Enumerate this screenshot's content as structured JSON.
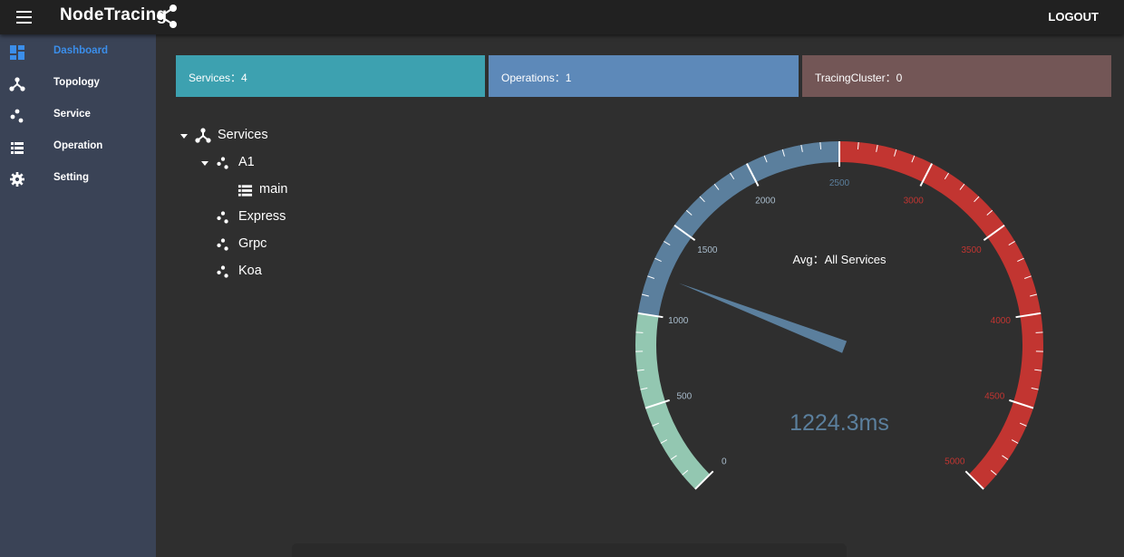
{
  "appbar": {
    "title": "NodeTracing",
    "logout": "LOGOUT"
  },
  "sidebar": {
    "items": [
      {
        "label": "Dashboard",
        "icon": "dashboard-icon",
        "active": true
      },
      {
        "label": "Topology",
        "icon": "topology-icon"
      },
      {
        "label": "Service",
        "icon": "service-icon"
      },
      {
        "label": "Operation",
        "icon": "operation-icon"
      },
      {
        "label": "Setting",
        "icon": "gear-icon"
      }
    ]
  },
  "stats": {
    "services": "Services：4",
    "operations": "Operations：1",
    "cluster": "TracingCluster：0",
    "colors": {
      "services": "#3da1b0",
      "operations": "#5d89b9",
      "cluster": "#735656"
    }
  },
  "tree": {
    "root": "Services",
    "a1": "A1",
    "main": "main",
    "express": "Express",
    "grpc": "Grpc",
    "koa": "Koa"
  },
  "gauge": {
    "title": "Avg：All Services",
    "value": 1224.3,
    "value_text": "1224.3ms",
    "min": 0,
    "max": 5000,
    "tick_labels": [
      "0",
      "500",
      "1000",
      "1500",
      "2000",
      "2500",
      "3000",
      "3500",
      "4000",
      "4500",
      "5000"
    ],
    "bands": [
      {
        "to": 0.2,
        "color": "#93c7b1"
      },
      {
        "to": 0.5,
        "color": "#5b7f9d"
      },
      {
        "to": 1.0,
        "color": "#c23531"
      }
    ],
    "pointer_color": "#5b7f9d",
    "value_color": "#5b7f9d"
  }
}
